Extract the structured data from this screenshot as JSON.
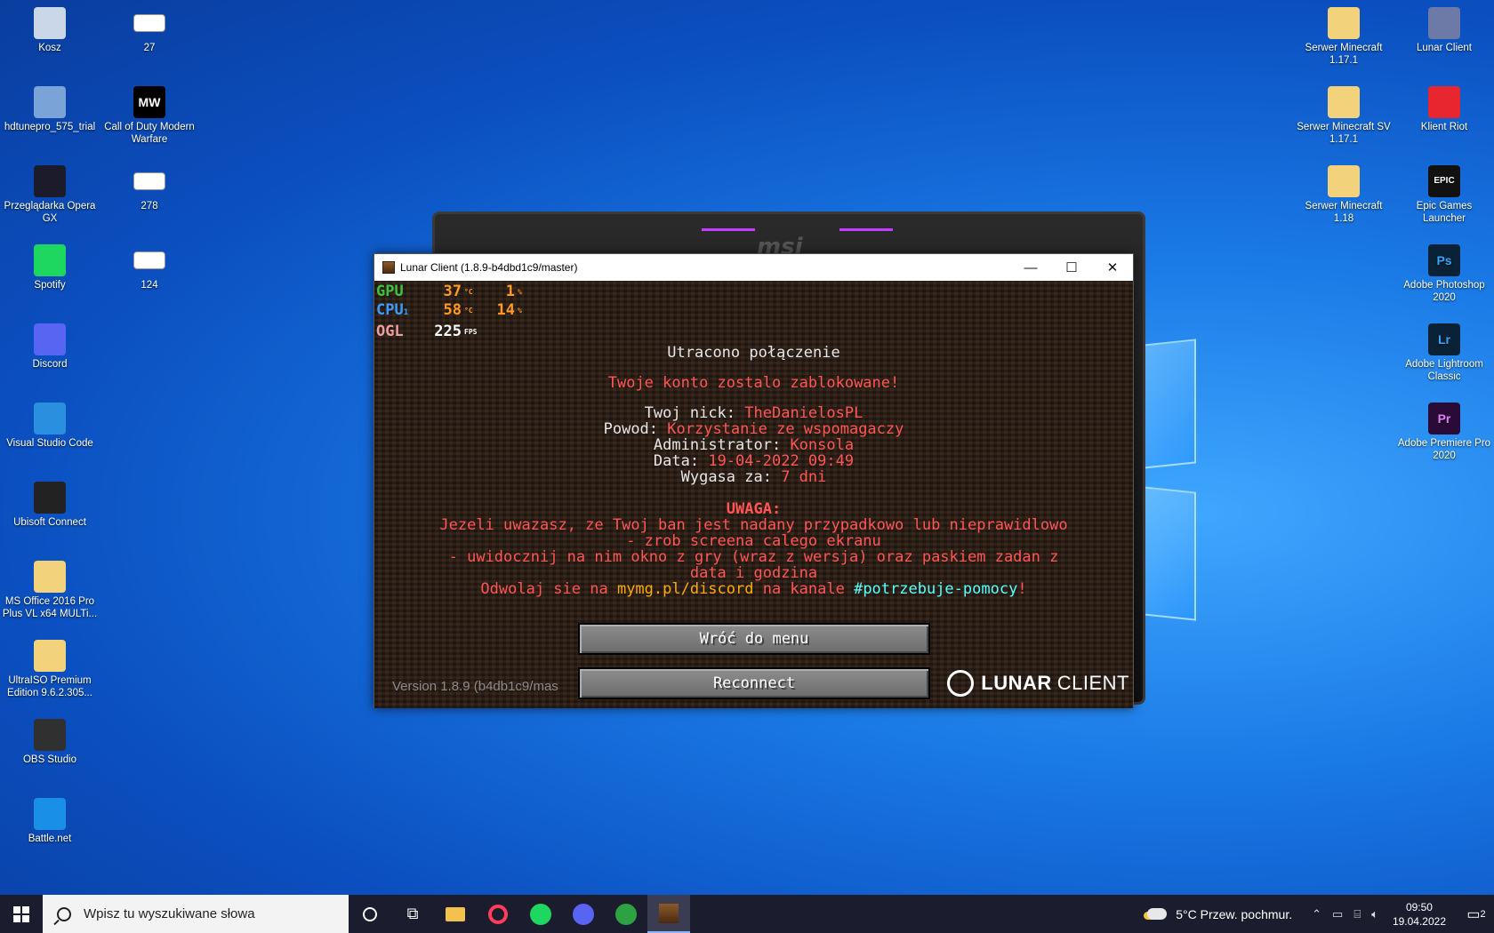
{
  "desktop": {
    "icons_left": [
      {
        "label": "Kosz",
        "icon": "recycle-bin-icon"
      },
      {
        "label": "hdtunepro_575_trial",
        "icon": "installer-icon"
      },
      {
        "label": "Przeglądarka Opera GX",
        "icon": "opera-gx-icon"
      },
      {
        "label": "Spotify",
        "icon": "spotify-icon"
      },
      {
        "label": "Discord",
        "icon": "discord-icon"
      },
      {
        "label": "Visual Studio Code",
        "icon": "vscode-icon"
      },
      {
        "label": "Ubisoft Connect",
        "icon": "ubisoft-icon"
      },
      {
        "label": "MS Office 2016 Pro Plus VL x64 MULTi...",
        "icon": "folder-icon"
      },
      {
        "label": "UltraISO Premium Edition 9.6.2.305...",
        "icon": "folder-icon"
      },
      {
        "label": "OBS Studio",
        "icon": "obs-icon"
      },
      {
        "label": "Battle.net",
        "icon": "battlenet-icon"
      }
    ],
    "icons_col2": [
      {
        "label": "27",
        "icon": "file-icon"
      },
      {
        "label": "Call of Duty Modern Warfare",
        "icon": "cod-mw-icon",
        "badge": "MW"
      },
      {
        "label": "278",
        "icon": "file-icon"
      },
      {
        "label": "124",
        "icon": "file-icon"
      }
    ],
    "icons_right_col1": [
      {
        "label": "Serwer Minecraft 1.17.1",
        "icon": "folder-icon"
      },
      {
        "label": "Serwer Minecraft SV 1.17.1",
        "icon": "folder-icon"
      },
      {
        "label": "Serwer Minecraft 1.18",
        "icon": "folder-icon"
      }
    ],
    "icons_right_col2": [
      {
        "label": "Lunar Client",
        "icon": "lunar-client-icon"
      },
      {
        "label": "Klient Riot",
        "icon": "riot-icon"
      },
      {
        "label": "Epic Games Launcher",
        "icon": "epic-games-icon",
        "badge": "EPIC"
      },
      {
        "label": "Adobe Photoshop 2020",
        "icon": "photoshop-icon",
        "badge": "Ps"
      },
      {
        "label": "Adobe Lightroom Classic",
        "icon": "lightroom-icon",
        "badge": "Lr"
      },
      {
        "label": "Adobe Premiere Pro 2020",
        "icon": "premiere-icon",
        "badge": "Pr"
      }
    ]
  },
  "backdrop": {
    "logo": "msi"
  },
  "window": {
    "title": "Lunar Client (1.8.9-b4dbd1c9/master)",
    "min": "—",
    "max": "☐",
    "close": "✕"
  },
  "overlay": {
    "gpu_label": "GPU",
    "gpu_temp": "37",
    "gpu_temp_unit": "°C",
    "gpu_load": "1",
    "gpu_load_unit": "%",
    "cpu_label": "CPU",
    "cpu_sub": "1",
    "cpu_temp": "58",
    "cpu_temp_unit": "°C",
    "cpu_load": "14",
    "cpu_load_unit": "%",
    "ogl_label": "OGL",
    "fps": "225",
    "fps_unit": "FPS"
  },
  "disconnect": {
    "heading": "Utracono połączenie",
    "banned": "Twoje konto zostalo zablokowane!",
    "nick_label": "Twoj nick: ",
    "nick_value": "TheDanielosPL",
    "reason_label": "Powod: ",
    "reason_value": "Korzystanie ze wspomagaczy",
    "admin_label": "Administrator: ",
    "admin_value": "Konsola",
    "date_label": "Data: ",
    "date_value": "19-04-2022 09:49",
    "expires_label": "Wygasa za: ",
    "expires_value": "7 dni",
    "warning": "UWAGA:",
    "line1": "Jezeli uwazasz, ze Twoj ban jest nadany przypadkowo lub nieprawidlowo",
    "line2": "- zrob screena calego ekranu",
    "line3": "- uwidocznij na nim okno z gry (wraz z wersja) oraz paskiem zadan z",
    "line4": "data i godzina",
    "appeal_a": "Odwolaj sie na ",
    "appeal_link": "mymg.pl/discord",
    "appeal_b": " na kanale ",
    "appeal_channel": "#potrzebuje-pomocy",
    "appeal_c": "!"
  },
  "buttons": {
    "menu": "Wróć do menu",
    "reconnect": "Reconnect"
  },
  "footer": {
    "version": "Version 1.8.9 (b4db1c9/mas",
    "brand_bold": "LUNAR",
    "brand_light": "CLIENT"
  },
  "taskbar": {
    "search_placeholder": "Wpisz tu wyszukiwane słowa",
    "weather": "5°C  Przew. pochmur.",
    "time": "09:50",
    "date": "19.04.2022",
    "notifications": "2"
  }
}
